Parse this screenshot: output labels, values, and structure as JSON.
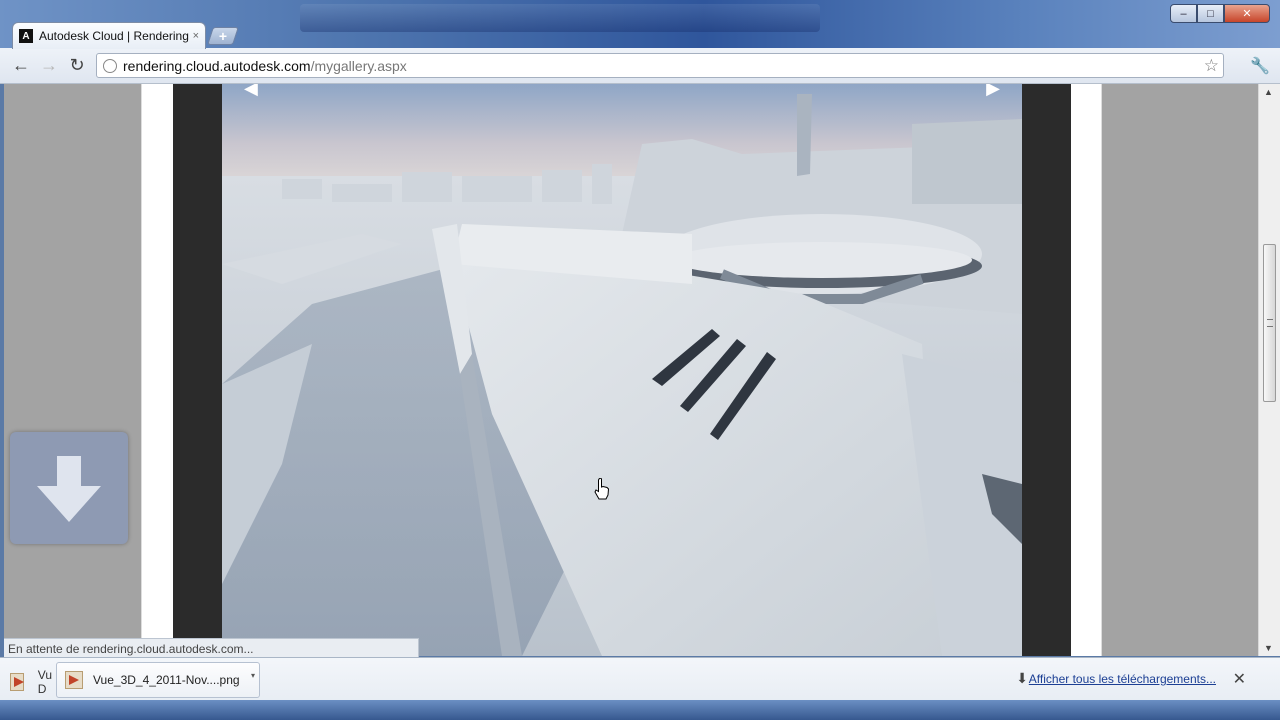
{
  "browser": {
    "tab": {
      "favicon_letter": "A",
      "title": "Autodesk Cloud | Rendering",
      "close": "×"
    },
    "new_tab": "+",
    "window_controls": {
      "minimize": "–",
      "maximize": "□",
      "close": "✕"
    },
    "nav": {
      "back": "←",
      "forward": "→",
      "reload": "↻"
    },
    "address": {
      "host": "rendering.cloud.autodesk.com",
      "path": "/mygallery.aspx"
    },
    "bookmark_star": "☆",
    "wrench": "🔧"
  },
  "gallery": {
    "prev_arrow": "◀",
    "next_arrow": "▶"
  },
  "status": {
    "text": "En attente de rendering.cloud.autodesk.com..."
  },
  "downloads": {
    "partial_item": {
      "line1": "Vu",
      "line2": "D"
    },
    "items": [
      {
        "name": "Vue_3D_4_2011-Nov....png",
        "menu": "▾"
      }
    ],
    "show_all": "Afficher tous les téléchargements...",
    "close": "✕"
  },
  "scrollbar": {
    "up": "▲",
    "down": "▼"
  }
}
